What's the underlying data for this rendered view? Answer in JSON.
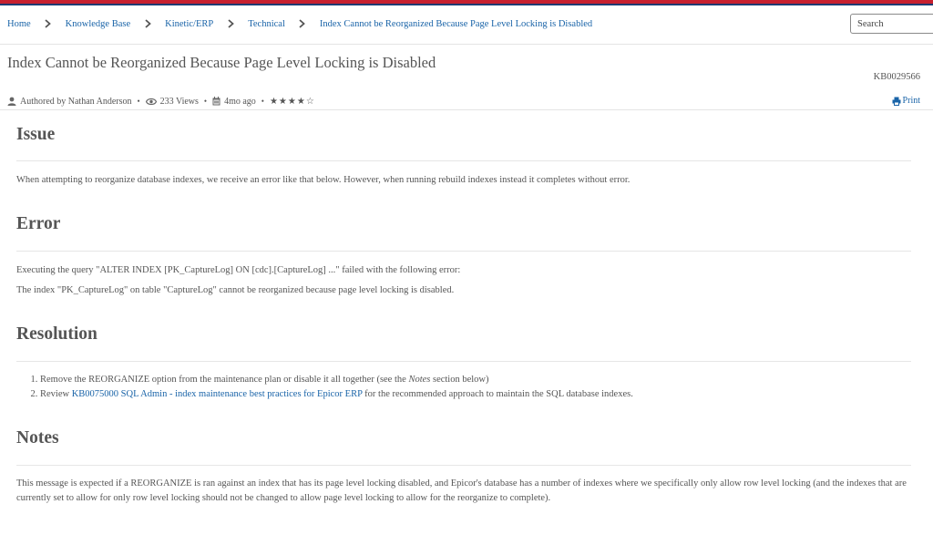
{
  "breadcrumb": {
    "items": [
      "Home",
      "Knowledge Base",
      "Kinetic/ERP",
      "Technical",
      "Index Cannot be Reorganized Because Page Level Locking is Disabled"
    ]
  },
  "search": {
    "placeholder": "Search"
  },
  "article": {
    "title": "Index Cannot be Reorganized Because Page Level Locking is Disabled",
    "kb_number": "KB0029566",
    "author": "Authored by Nathan Anderson",
    "views": "233 Views",
    "age": "4mo ago",
    "rating_stars": "★★★★☆",
    "print_label": "Print"
  },
  "sections": {
    "issue": {
      "heading": "Issue",
      "text": "When attempting to reorganize database indexes, we receive an error like that below. However, when running rebuild indexes instead it completes without error."
    },
    "error": {
      "heading": "Error",
      "line1": "Executing the query \"ALTER INDEX [PK_CaptureLog] ON [cdc].[CaptureLog] ...\" failed with the following error:",
      "line2": "The index \"PK_CaptureLog\" on table \"CaptureLog\" cannot be reorganized because page level locking is disabled."
    },
    "resolution": {
      "heading": "Resolution",
      "step1_pre": "Remove the REORGANIZE option from the maintenance plan or disable it all together (see the ",
      "step1_em": "Notes",
      "step1_post": " section below)",
      "step2_pre": "Review ",
      "step2_link": "KB0075000 SQL Admin - index maintenance best practices for Epicor ERP",
      "step2_post": " for the recommended approach to maintain the SQL database indexes."
    },
    "notes": {
      "heading": "Notes",
      "text": "This message is expected if a REORGANIZE is ran against an index that has its page level locking disabled, and Epicor's database has a number of indexes where we specifically only allow row level locking (and the indexes that are currently set to allow for only row level locking should not be changed to allow page level locking to allow for the reorganize to complete)."
    }
  },
  "icons": {
    "user": "user-icon",
    "eye": "eye-icon",
    "calendar": "calendar-icon",
    "print": "printer-icon",
    "chevron": "chevron-right-icon"
  },
  "colors": {
    "link": "#1a64a8",
    "text": "#555555",
    "topbar_red": "#c8202f",
    "topbar_blue": "#1f3b73"
  }
}
